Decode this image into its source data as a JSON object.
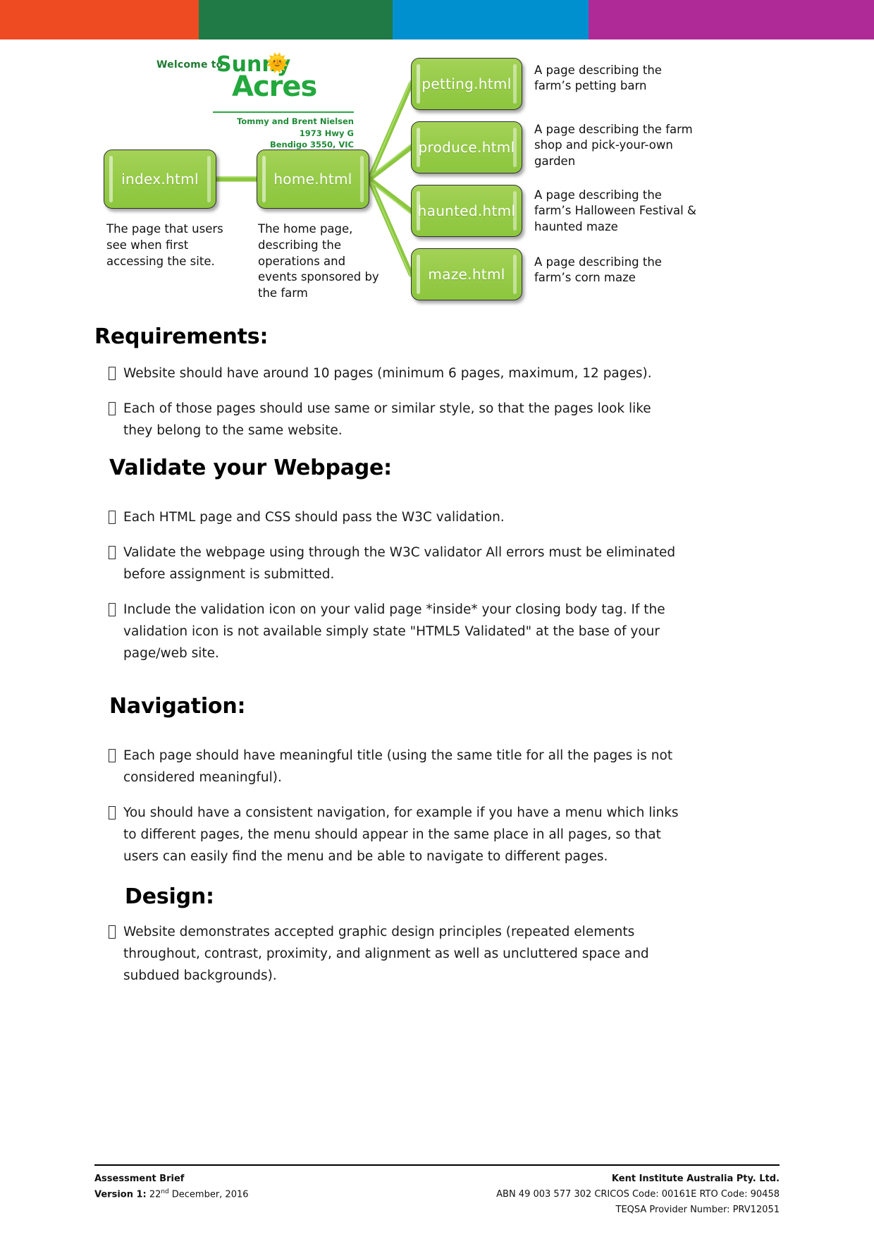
{
  "header_bands": [
    {
      "name": "orange",
      "color": "#EF4B23"
    },
    {
      "name": "green",
      "color": "#1F7A45"
    },
    {
      "name": "blue",
      "color": "#0090CF"
    },
    {
      "name": "magenta",
      "color": "#B02A97"
    }
  ],
  "diagram": {
    "logo": {
      "welcome": "Welcome to",
      "word1": "Sunny",
      "word2": "Acres",
      "sun_icon": "sun-icon",
      "address_lines": [
        "Tommy and Brent Nielsen",
        "1973 Hwy G",
        "Bendigo 3550, VIC"
      ]
    },
    "nodes": [
      {
        "id": "index",
        "label": "index.html"
      },
      {
        "id": "home",
        "label": "home.html"
      },
      {
        "id": "petting",
        "label": "petting.html"
      },
      {
        "id": "produce",
        "label": "produce.html"
      },
      {
        "id": "haunted",
        "label": "haunted.html"
      },
      {
        "id": "maze",
        "label": "maze.html"
      }
    ],
    "captions": {
      "index": "The page that users see when first accessing the site.",
      "home": "The home page, describing the operations and events sponsored by the farm"
    },
    "descriptions": {
      "petting": "A page describing the farm’s petting barn",
      "produce": "A page describing the farm shop and pick-your-own garden",
      "haunted": "A page describing the farm’s Halloween Festival & haunted maze",
      "maze": "A page describing the farm’s corn maze"
    },
    "node_color": "#8CC63E"
  },
  "sections": [
    {
      "id": "requirements",
      "heading": "Requirements:",
      "bullets": [
        "Website should have around 10 pages (minimum 6 pages, maximum, 12 pages).",
        "Each of those pages should use same or similar style, so that the pages look like they belong to the same website."
      ]
    },
    {
      "id": "validate",
      "heading": "Validate your Webpage:",
      "bullets": [
        "Each HTML page and CSS should pass the W3C validation.",
        "Validate the webpage using through the W3C validator All errors must be eliminated before assignment is submitted.",
        "Include the validation icon on your valid page *inside* your closing body tag. If the validation icon is not available simply state \"HTML5 Validated\" at the base of your page/web site."
      ]
    },
    {
      "id": "navigation",
      "heading": "Navigation:",
      "bullets": [
        "Each page should have meaningful title (using the same title for all the pages is not considered meaningful).",
        "You should have a consistent navigation, for example if you have a menu which links to different pages, the menu should appear in the same place in all pages, so that users can easily find the menu and be able to navigate to different pages."
      ]
    },
    {
      "id": "design",
      "heading": "Design:",
      "bullets": [
        "Website demonstrates accepted graphic design principles (repeated elements throughout, contrast, proximity, and alignment as well as uncluttered space and subdued backgrounds)."
      ]
    }
  ],
  "footer": {
    "left": {
      "title": "Assessment Brief",
      "version_label": "Version 1:",
      "version_day": "22",
      "version_sup": "nd",
      "version_rest": " December, 2016"
    },
    "right": {
      "company": "Kent Institute Australia Pty. Ltd.",
      "codes": "ABN 49 003 577 302  CRICOS Code: 00161E   RTO Code: 90458",
      "teqsa": "TEQSA Provider Number: PRV12051"
    }
  }
}
